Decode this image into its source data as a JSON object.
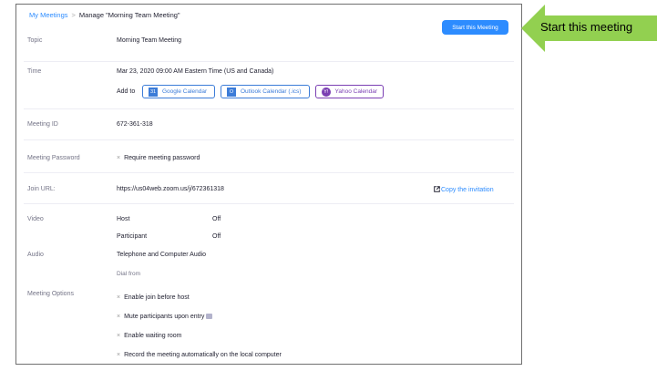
{
  "breadcrumb": {
    "parent": "My Meetings",
    "separator": ">",
    "current": "Manage \"Morning Team Meeting\""
  },
  "header": {
    "start_button": "Start this Meeting"
  },
  "topic": {
    "label": "Topic",
    "value": "Morning Team Meeting"
  },
  "time": {
    "label": "Time",
    "value": "Mar 23, 2020 09:00 AM Eastern Time (US and Canada)",
    "add_to": "Add to",
    "calendars": [
      {
        "label": "Google Calendar",
        "icon": "google-calendar-icon",
        "glyph": "31",
        "color": "#3c7cd8"
      },
      {
        "label": "Outlook Calendar (.ics)",
        "icon": "outlook-calendar-icon",
        "glyph": "O",
        "color": "#3c7cd8"
      },
      {
        "label": "Yahoo Calendar",
        "icon": "yahoo-calendar-icon",
        "glyph": "Y!",
        "color": "#7b3fb3"
      }
    ]
  },
  "meeting_id": {
    "label": "Meeting ID",
    "value": "672-361-318"
  },
  "password": {
    "label": "Meeting Password",
    "value": "Require meeting password",
    "mark": "×"
  },
  "join": {
    "label": "Join URL:",
    "value": "https://us04web.zoom.us/j/672361318",
    "copy": "Copy the invitation"
  },
  "video": {
    "label": "Video",
    "host_label": "Host",
    "host_value": "Off",
    "participant_label": "Participant",
    "participant_value": "Off"
  },
  "audio": {
    "label": "Audio",
    "value": "Telephone and Computer Audio",
    "dial_from": "Dial from"
  },
  "options": {
    "label": "Meeting Options",
    "mark": "×",
    "items": [
      "Enable join before host",
      "Mute participants upon entry",
      "Enable waiting room",
      "Record the meeting automatically on the local computer"
    ]
  },
  "callout": {
    "text": "Start this meeting",
    "color": "#92d050"
  },
  "colors": {
    "accent": "#2d8cff",
    "label": "#747487",
    "text": "#232333"
  }
}
